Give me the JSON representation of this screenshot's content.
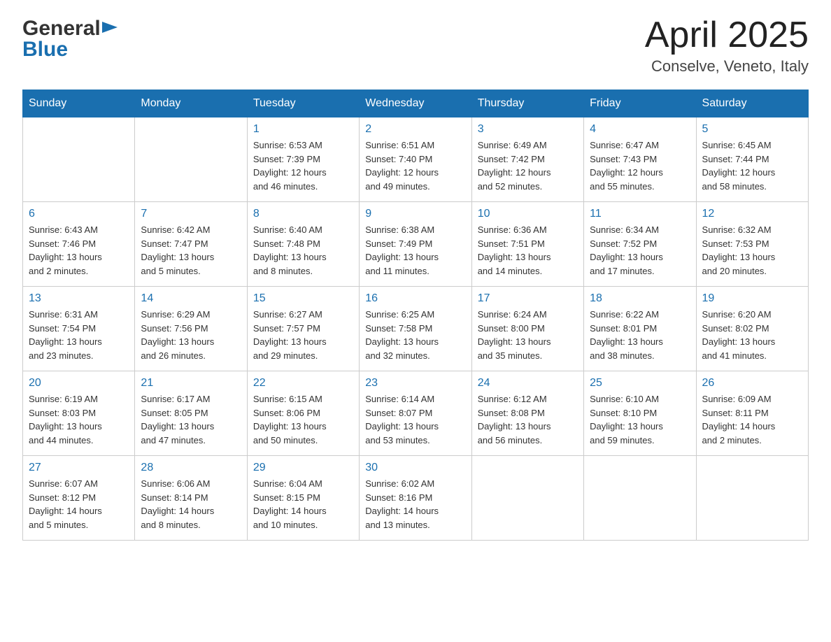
{
  "header": {
    "logo_general": "General",
    "logo_blue": "Blue",
    "title": "April 2025",
    "subtitle": "Conselve, Veneto, Italy"
  },
  "calendar": {
    "days_of_week": [
      "Sunday",
      "Monday",
      "Tuesday",
      "Wednesday",
      "Thursday",
      "Friday",
      "Saturday"
    ],
    "weeks": [
      [
        {
          "day": "",
          "info": ""
        },
        {
          "day": "",
          "info": ""
        },
        {
          "day": "1",
          "info": "Sunrise: 6:53 AM\nSunset: 7:39 PM\nDaylight: 12 hours\nand 46 minutes."
        },
        {
          "day": "2",
          "info": "Sunrise: 6:51 AM\nSunset: 7:40 PM\nDaylight: 12 hours\nand 49 minutes."
        },
        {
          "day": "3",
          "info": "Sunrise: 6:49 AM\nSunset: 7:42 PM\nDaylight: 12 hours\nand 52 minutes."
        },
        {
          "day": "4",
          "info": "Sunrise: 6:47 AM\nSunset: 7:43 PM\nDaylight: 12 hours\nand 55 minutes."
        },
        {
          "day": "5",
          "info": "Sunrise: 6:45 AM\nSunset: 7:44 PM\nDaylight: 12 hours\nand 58 minutes."
        }
      ],
      [
        {
          "day": "6",
          "info": "Sunrise: 6:43 AM\nSunset: 7:46 PM\nDaylight: 13 hours\nand 2 minutes."
        },
        {
          "day": "7",
          "info": "Sunrise: 6:42 AM\nSunset: 7:47 PM\nDaylight: 13 hours\nand 5 minutes."
        },
        {
          "day": "8",
          "info": "Sunrise: 6:40 AM\nSunset: 7:48 PM\nDaylight: 13 hours\nand 8 minutes."
        },
        {
          "day": "9",
          "info": "Sunrise: 6:38 AM\nSunset: 7:49 PM\nDaylight: 13 hours\nand 11 minutes."
        },
        {
          "day": "10",
          "info": "Sunrise: 6:36 AM\nSunset: 7:51 PM\nDaylight: 13 hours\nand 14 minutes."
        },
        {
          "day": "11",
          "info": "Sunrise: 6:34 AM\nSunset: 7:52 PM\nDaylight: 13 hours\nand 17 minutes."
        },
        {
          "day": "12",
          "info": "Sunrise: 6:32 AM\nSunset: 7:53 PM\nDaylight: 13 hours\nand 20 minutes."
        }
      ],
      [
        {
          "day": "13",
          "info": "Sunrise: 6:31 AM\nSunset: 7:54 PM\nDaylight: 13 hours\nand 23 minutes."
        },
        {
          "day": "14",
          "info": "Sunrise: 6:29 AM\nSunset: 7:56 PM\nDaylight: 13 hours\nand 26 minutes."
        },
        {
          "day": "15",
          "info": "Sunrise: 6:27 AM\nSunset: 7:57 PM\nDaylight: 13 hours\nand 29 minutes."
        },
        {
          "day": "16",
          "info": "Sunrise: 6:25 AM\nSunset: 7:58 PM\nDaylight: 13 hours\nand 32 minutes."
        },
        {
          "day": "17",
          "info": "Sunrise: 6:24 AM\nSunset: 8:00 PM\nDaylight: 13 hours\nand 35 minutes."
        },
        {
          "day": "18",
          "info": "Sunrise: 6:22 AM\nSunset: 8:01 PM\nDaylight: 13 hours\nand 38 minutes."
        },
        {
          "day": "19",
          "info": "Sunrise: 6:20 AM\nSunset: 8:02 PM\nDaylight: 13 hours\nand 41 minutes."
        }
      ],
      [
        {
          "day": "20",
          "info": "Sunrise: 6:19 AM\nSunset: 8:03 PM\nDaylight: 13 hours\nand 44 minutes."
        },
        {
          "day": "21",
          "info": "Sunrise: 6:17 AM\nSunset: 8:05 PM\nDaylight: 13 hours\nand 47 minutes."
        },
        {
          "day": "22",
          "info": "Sunrise: 6:15 AM\nSunset: 8:06 PM\nDaylight: 13 hours\nand 50 minutes."
        },
        {
          "day": "23",
          "info": "Sunrise: 6:14 AM\nSunset: 8:07 PM\nDaylight: 13 hours\nand 53 minutes."
        },
        {
          "day": "24",
          "info": "Sunrise: 6:12 AM\nSunset: 8:08 PM\nDaylight: 13 hours\nand 56 minutes."
        },
        {
          "day": "25",
          "info": "Sunrise: 6:10 AM\nSunset: 8:10 PM\nDaylight: 13 hours\nand 59 minutes."
        },
        {
          "day": "26",
          "info": "Sunrise: 6:09 AM\nSunset: 8:11 PM\nDaylight: 14 hours\nand 2 minutes."
        }
      ],
      [
        {
          "day": "27",
          "info": "Sunrise: 6:07 AM\nSunset: 8:12 PM\nDaylight: 14 hours\nand 5 minutes."
        },
        {
          "day": "28",
          "info": "Sunrise: 6:06 AM\nSunset: 8:14 PM\nDaylight: 14 hours\nand 8 minutes."
        },
        {
          "day": "29",
          "info": "Sunrise: 6:04 AM\nSunset: 8:15 PM\nDaylight: 14 hours\nand 10 minutes."
        },
        {
          "day": "30",
          "info": "Sunrise: 6:02 AM\nSunset: 8:16 PM\nDaylight: 14 hours\nand 13 minutes."
        },
        {
          "day": "",
          "info": ""
        },
        {
          "day": "",
          "info": ""
        },
        {
          "day": "",
          "info": ""
        }
      ]
    ]
  }
}
